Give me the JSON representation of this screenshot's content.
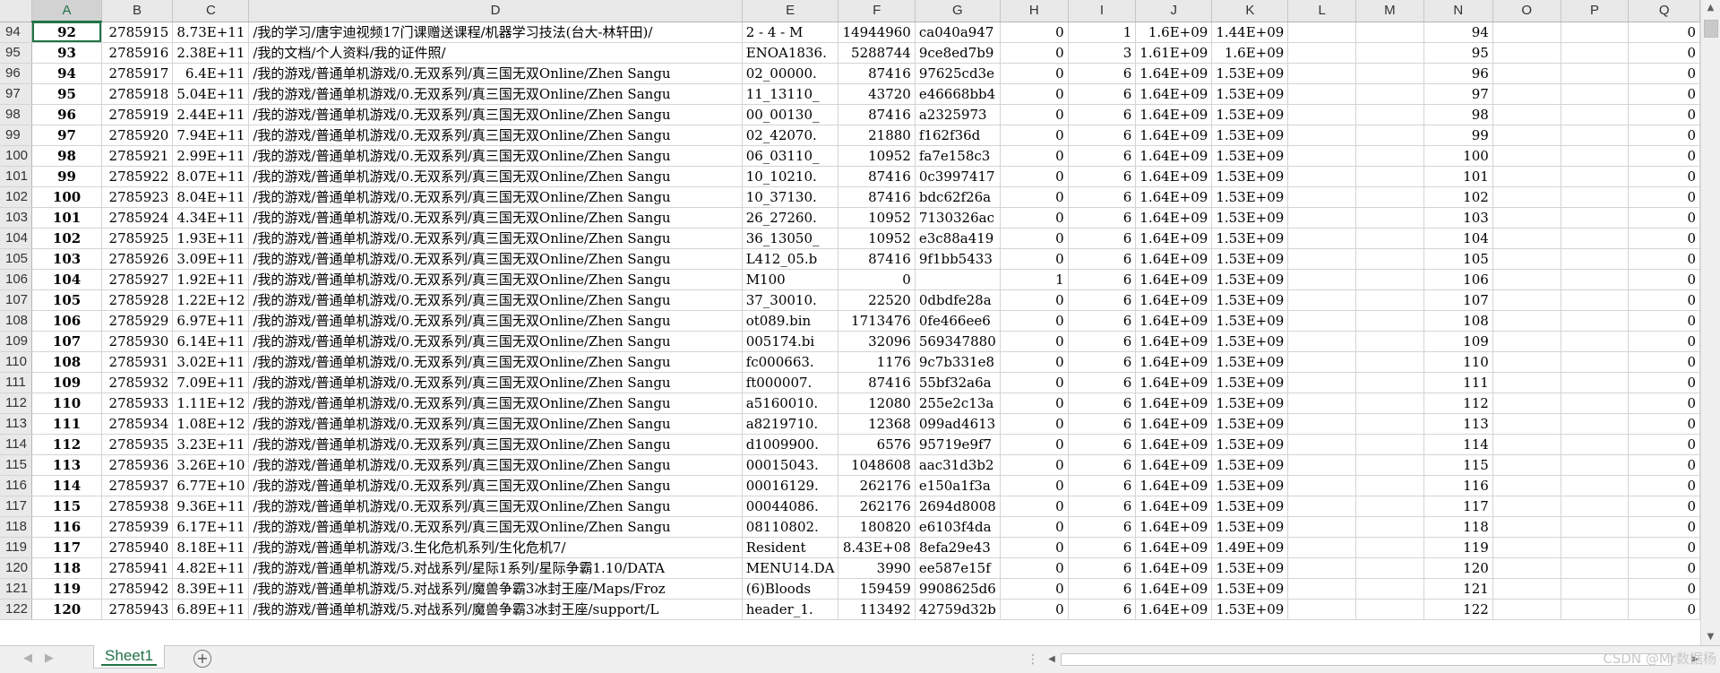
{
  "columns": [
    "A",
    "B",
    "C",
    "D",
    "E",
    "F",
    "G",
    "H",
    "I",
    "J",
    "K",
    "L",
    "M",
    "N",
    "O",
    "P",
    "Q"
  ],
  "active_column": "A",
  "rows": [
    {
      "n": "94",
      "a": "92",
      "b": "2785915",
      "c": "8.73E+11",
      "d": "/我的学习/唐宇迪视频17门课赠送课程/机器学习技法(台大-林轩田)/",
      "e": "2 - 4 - M",
      "f": "14944960",
      "g": "ca040a947",
      "h": "0",
      "i": "1",
      "j": "1.6E+09",
      "k": "1.44E+09",
      "q": "0"
    },
    {
      "n": "95",
      "a": "93",
      "b": "2785916",
      "c": "2.38E+11",
      "d": "/我的文档/个人资料/我的证件照/",
      "e": "ENOA1836.",
      "f": "5288744",
      "g": "9ce8ed7b9",
      "h": "0",
      "i": "3",
      "j": "1.61E+09",
      "k": "1.6E+09",
      "q": "0"
    },
    {
      "n": "96",
      "a": "94",
      "b": "2785917",
      "c": "6.4E+11",
      "d": "/我的游戏/普通单机游戏/0.无双系列/真三国无双Online/Zhen Sangu",
      "e": "02_00000.",
      "f": "87416",
      "g": "97625cd3e",
      "h": "0",
      "i": "6",
      "j": "1.64E+09",
      "k": "1.53E+09",
      "q": "0"
    },
    {
      "n": "97",
      "a": "95",
      "b": "2785918",
      "c": "5.04E+11",
      "d": "/我的游戏/普通单机游戏/0.无双系列/真三国无双Online/Zhen Sangu",
      "e": "11_13110_",
      "f": "43720",
      "g": "e46668bb4",
      "h": "0",
      "i": "6",
      "j": "1.64E+09",
      "k": "1.53E+09",
      "q": "0"
    },
    {
      "n": "98",
      "a": "96",
      "b": "2785919",
      "c": "2.44E+11",
      "d": "/我的游戏/普通单机游戏/0.无双系列/真三国无双Online/Zhen Sangu",
      "e": "00_00130_",
      "f": "87416",
      "g": "a2325973",
      "h": "0",
      "i": "6",
      "j": "1.64E+09",
      "k": "1.53E+09",
      "q": "0"
    },
    {
      "n": "99",
      "a": "97",
      "b": "2785920",
      "c": "7.94E+11",
      "d": "/我的游戏/普通单机游戏/0.无双系列/真三国无双Online/Zhen Sangu",
      "e": "02_42070.",
      "f": "21880",
      "g": "f162f36d",
      "h": "0",
      "i": "6",
      "j": "1.64E+09",
      "k": "1.53E+09",
      "q": "0"
    },
    {
      "n": "100",
      "a": "98",
      "b": "2785921",
      "c": "2.99E+11",
      "d": "/我的游戏/普通单机游戏/0.无双系列/真三国无双Online/Zhen Sangu",
      "e": "06_03110_",
      "f": "10952",
      "g": "fa7e158c3",
      "h": "0",
      "i": "6",
      "j": "1.64E+09",
      "k": "1.53E+09",
      "q": "0"
    },
    {
      "n": "101",
      "a": "99",
      "b": "2785922",
      "c": "8.07E+11",
      "d": "/我的游戏/普通单机游戏/0.无双系列/真三国无双Online/Zhen Sangu",
      "e": "10_10210.",
      "f": "87416",
      "g": "0c3997417",
      "h": "0",
      "i": "6",
      "j": "1.64E+09",
      "k": "1.53E+09",
      "q": "0"
    },
    {
      "n": "102",
      "a": "100",
      "b": "2785923",
      "c": "8.04E+11",
      "d": "/我的游戏/普通单机游戏/0.无双系列/真三国无双Online/Zhen Sangu",
      "e": "10_37130.",
      "f": "87416",
      "g": "bdc62f26a",
      "h": "0",
      "i": "6",
      "j": "1.64E+09",
      "k": "1.53E+09",
      "q": "0"
    },
    {
      "n": "103",
      "a": "101",
      "b": "2785924",
      "c": "4.34E+11",
      "d": "/我的游戏/普通单机游戏/0.无双系列/真三国无双Online/Zhen Sangu",
      "e": "26_27260.",
      "f": "10952",
      "g": "7130326ac",
      "h": "0",
      "i": "6",
      "j": "1.64E+09",
      "k": "1.53E+09",
      "q": "0"
    },
    {
      "n": "104",
      "a": "102",
      "b": "2785925",
      "c": "1.93E+11",
      "d": "/我的游戏/普通单机游戏/0.无双系列/真三国无双Online/Zhen Sangu",
      "e": "36_13050_",
      "f": "10952",
      "g": "e3c88a419",
      "h": "0",
      "i": "6",
      "j": "1.64E+09",
      "k": "1.53E+09",
      "q": "0"
    },
    {
      "n": "105",
      "a": "103",
      "b": "2785926",
      "c": "3.09E+11",
      "d": "/我的游戏/普通单机游戏/0.无双系列/真三国无双Online/Zhen Sangu",
      "e": "L412_05.b",
      "f": "87416",
      "g": "9f1bb5433",
      "h": "0",
      "i": "6",
      "j": "1.64E+09",
      "k": "1.53E+09",
      "q": "0"
    },
    {
      "n": "106",
      "a": "104",
      "b": "2785927",
      "c": "1.92E+11",
      "d": "/我的游戏/普通单机游戏/0.无双系列/真三国无双Online/Zhen Sangu",
      "e": "M100",
      "f": "0",
      "g": "",
      "h": "1",
      "i": "6",
      "j": "1.64E+09",
      "k": "1.53E+09",
      "q": "0"
    },
    {
      "n": "107",
      "a": "105",
      "b": "2785928",
      "c": "1.22E+12",
      "d": "/我的游戏/普通单机游戏/0.无双系列/真三国无双Online/Zhen Sangu",
      "e": "37_30010.",
      "f": "22520",
      "g": "0dbdfe28a",
      "h": "0",
      "i": "6",
      "j": "1.64E+09",
      "k": "1.53E+09",
      "q": "0"
    },
    {
      "n": "108",
      "a": "106",
      "b": "2785929",
      "c": "6.97E+11",
      "d": "/我的游戏/普通单机游戏/0.无双系列/真三国无双Online/Zhen Sangu",
      "e": "ot089.bin",
      "f": "1713476",
      "g": "0fe466ee6",
      "h": "0",
      "i": "6",
      "j": "1.64E+09",
      "k": "1.53E+09",
      "q": "0"
    },
    {
      "n": "109",
      "a": "107",
      "b": "2785930",
      "c": "6.14E+11",
      "d": "/我的游戏/普通单机游戏/0.无双系列/真三国无双Online/Zhen Sangu",
      "e": "005174.bi",
      "f": "32096",
      "g": "569347880",
      "h": "0",
      "i": "6",
      "j": "1.64E+09",
      "k": "1.53E+09",
      "q": "0"
    },
    {
      "n": "110",
      "a": "108",
      "b": "2785931",
      "c": "3.02E+11",
      "d": "/我的游戏/普通单机游戏/0.无双系列/真三国无双Online/Zhen Sangu",
      "e": "fc000663.",
      "f": "1176",
      "g": "9c7b331e8",
      "h": "0",
      "i": "6",
      "j": "1.64E+09",
      "k": "1.53E+09",
      "q": "0"
    },
    {
      "n": "111",
      "a": "109",
      "b": "2785932",
      "c": "7.09E+11",
      "d": "/我的游戏/普通单机游戏/0.无双系列/真三国无双Online/Zhen Sangu",
      "e": "ft000007.",
      "f": "87416",
      "g": "55bf32a6a",
      "h": "0",
      "i": "6",
      "j": "1.64E+09",
      "k": "1.53E+09",
      "q": "0"
    },
    {
      "n": "112",
      "a": "110",
      "b": "2785933",
      "c": "1.11E+12",
      "d": "/我的游戏/普通单机游戏/0.无双系列/真三国无双Online/Zhen Sangu",
      "e": "a5160010.",
      "f": "12080",
      "g": "255e2c13a",
      "h": "0",
      "i": "6",
      "j": "1.64E+09",
      "k": "1.53E+09",
      "q": "0"
    },
    {
      "n": "113",
      "a": "111",
      "b": "2785934",
      "c": "1.08E+12",
      "d": "/我的游戏/普通单机游戏/0.无双系列/真三国无双Online/Zhen Sangu",
      "e": "a8219710.",
      "f": "12368",
      "g": "099ad4613",
      "h": "0",
      "i": "6",
      "j": "1.64E+09",
      "k": "1.53E+09",
      "q": "0"
    },
    {
      "n": "114",
      "a": "112",
      "b": "2785935",
      "c": "3.23E+11",
      "d": "/我的游戏/普通单机游戏/0.无双系列/真三国无双Online/Zhen Sangu",
      "e": "d1009900.",
      "f": "6576",
      "g": "95719e9f7",
      "h": "0",
      "i": "6",
      "j": "1.64E+09",
      "k": "1.53E+09",
      "q": "0"
    },
    {
      "n": "115",
      "a": "113",
      "b": "2785936",
      "c": "3.26E+10",
      "d": "/我的游戏/普通单机游戏/0.无双系列/真三国无双Online/Zhen Sangu",
      "e": "00015043.",
      "f": "1048608",
      "g": "aac31d3b2",
      "h": "0",
      "i": "6",
      "j": "1.64E+09",
      "k": "1.53E+09",
      "q": "0"
    },
    {
      "n": "116",
      "a": "114",
      "b": "2785937",
      "c": "6.77E+10",
      "d": "/我的游戏/普通单机游戏/0.无双系列/真三国无双Online/Zhen Sangu",
      "e": "00016129.",
      "f": "262176",
      "g": "e150a1f3a",
      "h": "0",
      "i": "6",
      "j": "1.64E+09",
      "k": "1.53E+09",
      "q": "0"
    },
    {
      "n": "117",
      "a": "115",
      "b": "2785938",
      "c": "9.36E+11",
      "d": "/我的游戏/普通单机游戏/0.无双系列/真三国无双Online/Zhen Sangu",
      "e": "00044086.",
      "f": "262176",
      "g": "2694d8008",
      "h": "0",
      "i": "6",
      "j": "1.64E+09",
      "k": "1.53E+09",
      "q": "0"
    },
    {
      "n": "118",
      "a": "116",
      "b": "2785939",
      "c": "6.17E+11",
      "d": "/我的游戏/普通单机游戏/0.无双系列/真三国无双Online/Zhen Sangu",
      "e": "08110802.",
      "f": "180820",
      "g": "e6103f4da",
      "h": "0",
      "i": "6",
      "j": "1.64E+09",
      "k": "1.53E+09",
      "q": "0"
    },
    {
      "n": "119",
      "a": "117",
      "b": "2785940",
      "c": "8.18E+11",
      "d": "/我的游戏/普通单机游戏/3.生化危机系列/生化危机7/",
      "e": "Resident",
      "f": "8.43E+08",
      "g": "8efa29e43",
      "h": "0",
      "i": "6",
      "j": "1.64E+09",
      "k": "1.49E+09",
      "q": "0"
    },
    {
      "n": "120",
      "a": "118",
      "b": "2785941",
      "c": "4.82E+11",
      "d": "/我的游戏/普通单机游戏/5.对战系列/星际1系列/星际争霸1.10/DATA",
      "e": "MENU14.DA",
      "f": "3990",
      "g": "ee587e15f",
      "h": "0",
      "i": "6",
      "j": "1.64E+09",
      "k": "1.53E+09",
      "q": "0"
    },
    {
      "n": "121",
      "a": "119",
      "b": "2785942",
      "c": "8.39E+11",
      "d": "/我的游戏/普通单机游戏/5.对战系列/魔兽争霸3冰封王座/Maps/Froz",
      "e": "(6)Bloods",
      "f": "159459",
      "g": "9908625d6",
      "h": "0",
      "i": "6",
      "j": "1.64E+09",
      "k": "1.53E+09",
      "q": "0"
    },
    {
      "n": "122",
      "a": "120",
      "b": "2785943",
      "c": "6.89E+11",
      "d": "/我的游戏/普通单机游戏/5.对战系列/魔兽争霸3冰封王座/support/L",
      "e": "header_1.",
      "f": "113492",
      "g": "42759d32b",
      "h": "0",
      "i": "6",
      "j": "1.64E+09",
      "k": "1.53E+09",
      "q": "0"
    }
  ],
  "sheet_tab": "Sheet1",
  "add_sheet_glyph": "+",
  "watermark": "CSDN @Mr数据杨",
  "colors": {
    "accent": "#217346",
    "header_bg": "#e9e9e9",
    "grid": "#d4d4d4"
  }
}
